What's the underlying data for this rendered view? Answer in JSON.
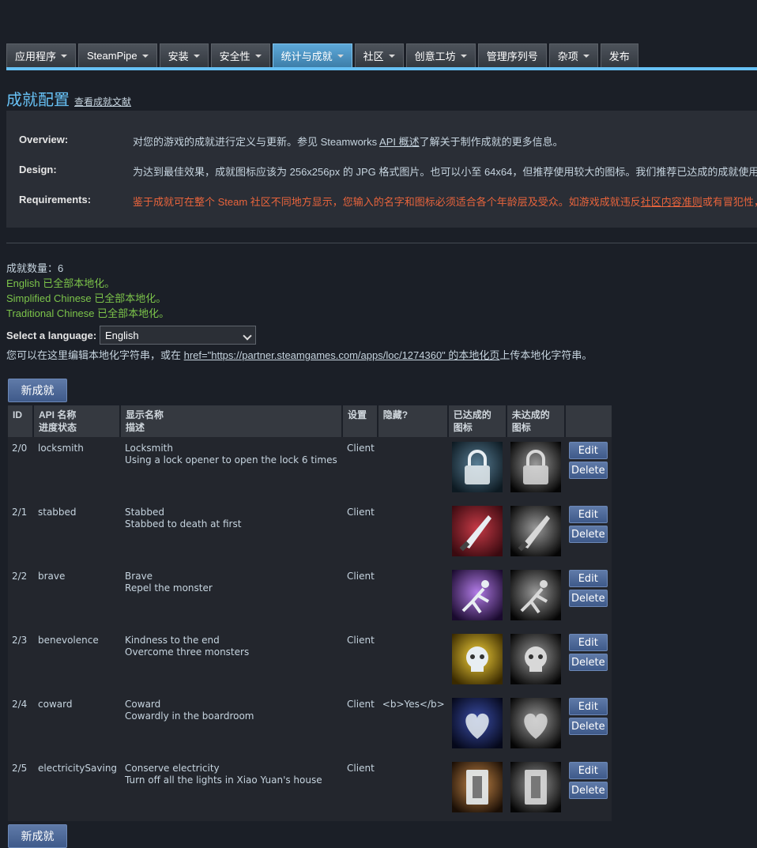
{
  "nav": {
    "tabs": [
      {
        "label": "应用程序",
        "dropdown": true
      },
      {
        "label": "SteamPipe",
        "dropdown": true
      },
      {
        "label": "安装",
        "dropdown": true
      },
      {
        "label": "安全性",
        "dropdown": true
      },
      {
        "label": "统计与成就",
        "dropdown": true,
        "active": true
      },
      {
        "label": "社区",
        "dropdown": true
      },
      {
        "label": "创意工坊",
        "dropdown": true
      },
      {
        "label": "管理序列号",
        "dropdown": false
      },
      {
        "label": "杂项",
        "dropdown": true
      },
      {
        "label": "发布",
        "dropdown": false
      }
    ]
  },
  "page": {
    "title": "成就配置",
    "doc_link": "查看成就文献"
  },
  "info": {
    "overview_label": "Overview:",
    "overview_pre": "对您的游戏的成就进行定义与更新。参见 Steamworks ",
    "overview_link": "API 概述",
    "overview_post": "了解关于制作成就的更多信息。",
    "design_label": "Design:",
    "design_text": "为达到最佳效果，成就图标应该为 256x256px 的 JPG 格式图片。也可以小至 64x64，但推荐使用较大的图标。我们推荐已达成的成就使用",
    "requirements_label": "Requirements:",
    "requirements_pre": "鉴于成就可在整个 Steam 社区不同地方显示，您输入的名字和图标必须适合各个年龄层及受众。如游戏成就违反",
    "requirements_link": "社区内容准则",
    "requirements_post": "或有冒犯性，"
  },
  "stats": {
    "count": "成就数量：6",
    "localized": [
      "English 已全部本地化。",
      "Simplified Chinese 已全部本地化。",
      "Traditional Chinese 已全部本地化。"
    ],
    "select_label": "Select a language:",
    "selected_language": "English",
    "loc_pre": "您可以在这里编辑本地化字符串，或在 ",
    "loc_link": "href=\"https://partner.steamgames.com/apps/loc/1274360\" 的本地化页",
    "loc_post": "上传本地化字符串。"
  },
  "new_button": "新成就",
  "table": {
    "headers": {
      "id": "ID",
      "api": "API 名称",
      "api_sub": "进度状态",
      "display": "显示名称",
      "display_sub": "描述",
      "settings": "设置",
      "hidden": "隐藏?",
      "achieved": "已达成的",
      "achieved_sub": "图标",
      "unachieved": "未达成的",
      "unachieved_sub": "图标"
    },
    "edit_label": "Edit",
    "delete_label": "Delete",
    "rows": [
      {
        "id": "2/0",
        "api": "locksmith",
        "name": "Locksmith",
        "desc": "Using a lock opener to open the lock 6 times",
        "setting": "Client",
        "hidden": "",
        "icon": "lock-icon"
      },
      {
        "id": "2/1",
        "api": "stabbed",
        "name": "Stabbed",
        "desc": "Stabbed to death at first",
        "setting": "Client",
        "hidden": "",
        "icon": "knife-icon"
      },
      {
        "id": "2/2",
        "api": "brave",
        "name": "Brave",
        "desc": "Repel the monster",
        "setting": "Client",
        "hidden": "",
        "icon": "figure-icon"
      },
      {
        "id": "2/3",
        "api": "benevolence",
        "name": "Kindness to the end",
        "desc": "Overcome three monsters",
        "setting": "Client",
        "hidden": "",
        "icon": "skull-icon"
      },
      {
        "id": "2/4",
        "api": "coward",
        "name": "Coward",
        "desc": "Cowardly in the boardroom",
        "setting": "Client",
        "hidden": "<b>Yes</b>",
        "icon": "heart-icon"
      },
      {
        "id": "2/5",
        "api": "electricitySaving",
        "name": "Conserve electricity",
        "desc": "Turn off all the lights in Xiao Yuan's house",
        "setting": "Client",
        "hidden": "",
        "icon": "switch-icon"
      }
    ]
  }
}
